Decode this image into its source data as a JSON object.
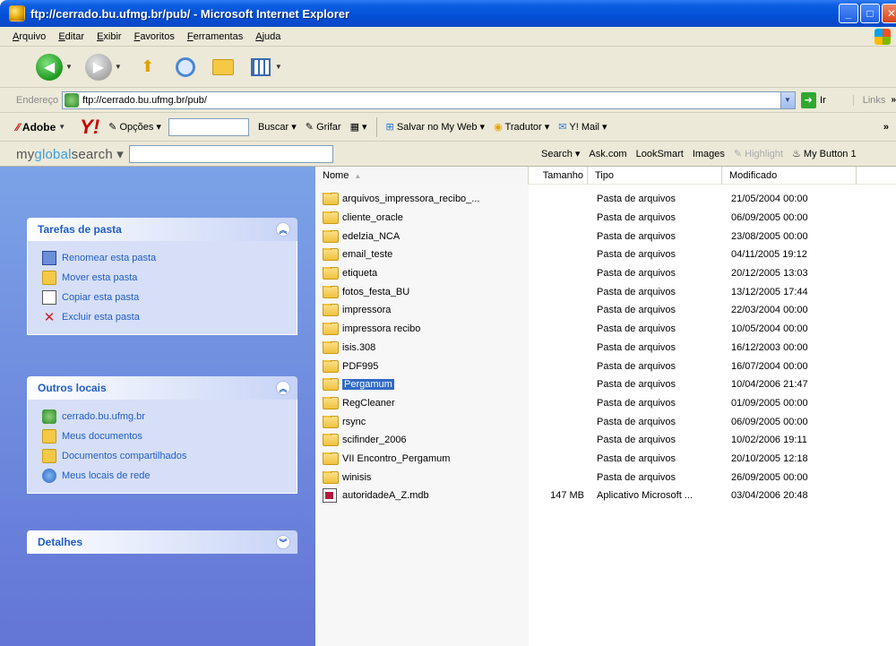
{
  "window": {
    "title": "ftp://cerrado.bu.ufmg.br/pub/ - Microsoft Internet Explorer"
  },
  "menu": [
    "Arquivo",
    "Editar",
    "Exibir",
    "Favoritos",
    "Ferramentas",
    "Ajuda"
  ],
  "address": {
    "label": "Endereço",
    "value": "ftp://cerrado.bu.ufmg.br/pub/",
    "go": "Ir",
    "links": "Links",
    "links_more": "»"
  },
  "yahoo": {
    "adobe": "Adobe",
    "options": "Opções",
    "buscar": "Buscar",
    "grifar": "Grifar",
    "salvar": "Salvar no My Web",
    "tradutor": "Tradutor",
    "mail": "Y! Mail",
    "more": "»"
  },
  "myg": {
    "logo_a": "my",
    "logo_b": "global",
    "logo_c": "search",
    "search": "Search",
    "ask": "Ask.com",
    "looksmart": "LookSmart",
    "images": "Images",
    "highlight": "Highlight",
    "mybutton": "My Button 1"
  },
  "tasks": {
    "folder_tasks": {
      "title": "Tarefas de pasta",
      "items": [
        "Renomear esta pasta",
        "Mover esta pasta",
        "Copiar esta pasta",
        "Excluir esta pasta"
      ]
    },
    "other_places": {
      "title": "Outros locais",
      "items": [
        "cerrado.bu.ufmg.br",
        "Meus documentos",
        "Documentos compartilhados",
        "Meus locais de rede"
      ]
    },
    "details": {
      "title": "Detalhes"
    }
  },
  "columns": {
    "name": "Nome",
    "size": "Tamanho",
    "type": "Tipo",
    "modified": "Modificado"
  },
  "files": [
    {
      "name": "arquivos_impressora_recibo_...",
      "size": "",
      "type": "Pasta de arquivos",
      "modified": "21/05/2004 00:00",
      "kind": "folder"
    },
    {
      "name": "cliente_oracle",
      "size": "",
      "type": "Pasta de arquivos",
      "modified": "06/09/2005 00:00",
      "kind": "folder"
    },
    {
      "name": "edelzia_NCA",
      "size": "",
      "type": "Pasta de arquivos",
      "modified": "23/08/2005 00:00",
      "kind": "folder"
    },
    {
      "name": "email_teste",
      "size": "",
      "type": "Pasta de arquivos",
      "modified": "04/11/2005 19:12",
      "kind": "folder"
    },
    {
      "name": "etiqueta",
      "size": "",
      "type": "Pasta de arquivos",
      "modified": "20/12/2005 13:03",
      "kind": "folder"
    },
    {
      "name": "fotos_festa_BU",
      "size": "",
      "type": "Pasta de arquivos",
      "modified": "13/12/2005 17:44",
      "kind": "folder"
    },
    {
      "name": "impressora",
      "size": "",
      "type": "Pasta de arquivos",
      "modified": "22/03/2004 00:00",
      "kind": "folder"
    },
    {
      "name": "impressora recibo",
      "size": "",
      "type": "Pasta de arquivos",
      "modified": "10/05/2004 00:00",
      "kind": "folder"
    },
    {
      "name": "isis.308",
      "size": "",
      "type": "Pasta de arquivos",
      "modified": "16/12/2003 00:00",
      "kind": "folder"
    },
    {
      "name": "PDF995",
      "size": "",
      "type": "Pasta de arquivos",
      "modified": "16/07/2004 00:00",
      "kind": "folder"
    },
    {
      "name": "Pergamum",
      "size": "",
      "type": "Pasta de arquivos",
      "modified": "10/04/2006 21:47",
      "kind": "folder",
      "selected": true
    },
    {
      "name": "RegCleaner",
      "size": "",
      "type": "Pasta de arquivos",
      "modified": "01/09/2005 00:00",
      "kind": "folder"
    },
    {
      "name": "rsync",
      "size": "",
      "type": "Pasta de arquivos",
      "modified": "06/09/2005 00:00",
      "kind": "folder"
    },
    {
      "name": "scifinder_2006",
      "size": "",
      "type": "Pasta de arquivos",
      "modified": "10/02/2006 19:11",
      "kind": "folder"
    },
    {
      "name": "VII Encontro_Pergamum",
      "size": "",
      "type": "Pasta de arquivos",
      "modified": "20/10/2005 12:18",
      "kind": "folder"
    },
    {
      "name": "winisis",
      "size": "",
      "type": "Pasta de arquivos",
      "modified": "26/09/2005 00:00",
      "kind": "folder"
    },
    {
      "name": "autoridadeA_Z.mdb",
      "size": "147 MB",
      "type": "Aplicativo Microsoft ...",
      "modified": "03/04/2006 20:48",
      "kind": "mdb"
    }
  ]
}
